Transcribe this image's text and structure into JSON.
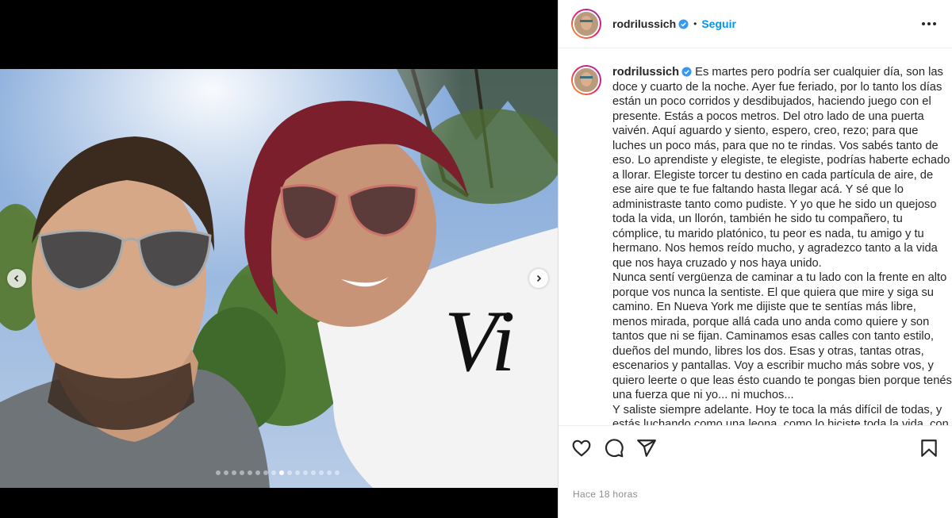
{
  "post": {
    "username": "rodrilussich",
    "separator": "•",
    "follow_label": "Seguir",
    "caption_paragraphs": [
      "Es martes pero podría ser cualquier día, son las doce y cuarto de la noche. Ayer fue feriado, por lo tanto los días están un poco corridos y desdibujados, haciendo juego con el presente. Estás a pocos metros. Del otro lado de una puerta vaivén. Aquí aguardo y siento, espero, creo, rezo; para que luches un poco más, para que no te rindas. Vos sabés tanto de eso. Lo aprendiste y elegiste, te elegiste, podrías haberte echado a llorar. Elegiste torcer tu destino en cada partícula de aire, de ese aire que te fue faltando hasta llegar acá. Y sé que lo administraste tanto como pudiste. Y yo que he sido un quejoso toda la vida, un llorón, también he sido tu compañero, tu cómplice, tu marido platónico, tu peor es nada, tu amigo y tu hermano. Nos hemos reído mucho, y agradezco tanto a la vida que nos haya cruzado y nos haya unido.",
      "Nunca sentí vergüenza de caminar a tu lado con la frente en alto porque vos nunca la sentiste. El que quiera que mire y siga su camino. En Nueva York me dijiste que te sentías más libre, menos mirada, porque allá cada uno anda como quiere y son tantos que ni se fijan. Caminamos esas calles con tanto estilo, dueños del mundo, libres los dos. Esas y otras, tantas otras, escenarios y pantallas. Voy a escribir mucho más sobre vos, y quiero leerte o que leas ésto cuando te pongas bien porque tenés una fuerza que ni yo... ni muchos...",
      "Y saliste siempre adelante. Hoy te toca la más difícil de todas, y estás luchando como una leona, como lo hiciste toda la vida, con una dignidad que admiro y honro cada día."
    ],
    "timestamp": "Hace 18 horas",
    "carousel": {
      "total": 16,
      "active_index": 8
    },
    "photo_text": "Vi"
  },
  "icons": {
    "verified": "verified-badge-icon",
    "more": "more-options-icon",
    "like": "heart-icon",
    "comment": "comment-bubble-icon",
    "share": "paper-plane-icon",
    "save": "bookmark-icon",
    "prev": "chevron-left-icon",
    "next": "chevron-right-icon"
  },
  "colors": {
    "link_blue": "#0095f6",
    "verified_blue": "#3897f0",
    "text": "#262626",
    "muted": "#8e8e8e"
  }
}
